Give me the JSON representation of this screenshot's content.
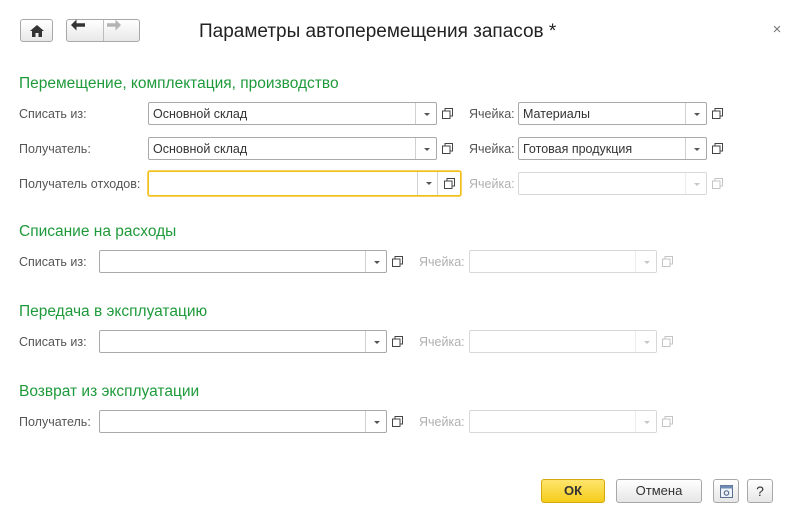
{
  "window": {
    "title": "Параметры автоперемещения запасов *",
    "close_glyph": "×"
  },
  "nav": {
    "home_icon": "home-icon",
    "back_icon": "arrow-left-icon",
    "forward_icon": "arrow-right-icon"
  },
  "sections": {
    "movement": {
      "title": "Перемещение, комплектация, производство",
      "write_off_label": "Списать из:",
      "write_off_value": "Основной склад",
      "write_off_cell_label": "Ячейка:",
      "write_off_cell_value": "Материалы",
      "recipient_label": "Получатель:",
      "recipient_value": "Основной склад",
      "recipient_cell_label": "Ячейка:",
      "recipient_cell_value": "Готовая продукция",
      "waste_label": "Получатель отходов:",
      "waste_value": "",
      "waste_cell_label": "Ячейка:",
      "waste_cell_value": ""
    },
    "expenses": {
      "title": "Списание на расходы",
      "write_off_label": "Списать из:",
      "write_off_value": "",
      "cell_label": "Ячейка:",
      "cell_value": ""
    },
    "exploitation": {
      "title": "Передача в эксплуатацию",
      "write_off_label": "Списать из:",
      "write_off_value": "",
      "cell_label": "Ячейка:",
      "cell_value": ""
    },
    "return": {
      "title": "Возврат из эксплуатации",
      "recipient_label": "Получатель:",
      "recipient_value": "",
      "cell_label": "Ячейка:",
      "cell_value": ""
    }
  },
  "footer": {
    "ok_label": "ОК",
    "cancel_label": "Отмена",
    "help_label": "?",
    "settings_icon": "form-settings-icon"
  },
  "colors": {
    "section_title": "#1e9a3b",
    "ok_button": "#f5cc1a",
    "focus_border": "#f2c01b"
  }
}
